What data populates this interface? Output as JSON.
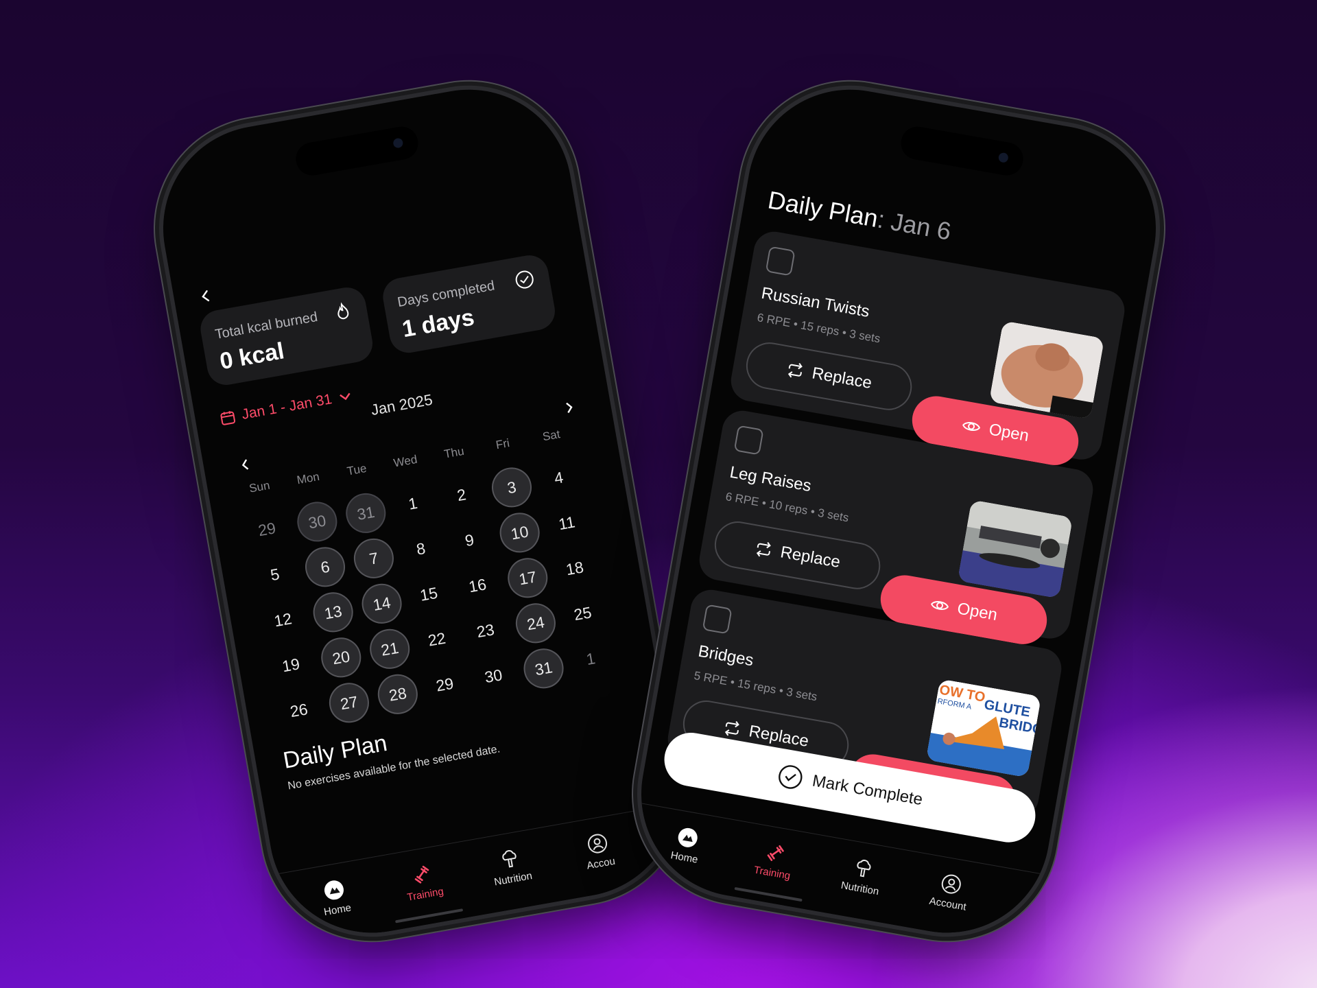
{
  "colors": {
    "accent": "#f34a62",
    "card": "#1c1c1e",
    "muted": "#8d8d92"
  },
  "calendar_screen": {
    "kcal_label": "Total kcal burned",
    "kcal_value": "0 kcal",
    "days_label": "Days completed",
    "days_value": "1 days",
    "range": "Jan 1 - Jan 31",
    "month": "Jan 2025",
    "weekdays": [
      "Sun",
      "Mon",
      "Tue",
      "Wed",
      "Thu",
      "Fri",
      "Sat"
    ],
    "weeks": [
      [
        "29",
        "30",
        "31",
        "1",
        "2",
        "3",
        "4"
      ],
      [
        "5",
        "6",
        "7",
        "8",
        "9",
        "10",
        "11"
      ],
      [
        "12",
        "13",
        "14",
        "15",
        "16",
        "17",
        "18"
      ],
      [
        "19",
        "20",
        "21",
        "22",
        "23",
        "24",
        "25"
      ],
      [
        "26",
        "27",
        "28",
        "29",
        "30",
        "31",
        "1"
      ]
    ],
    "daily_plan_title": "Daily Plan",
    "daily_plan_empty": "No exercises available for the selected date."
  },
  "plan_screen": {
    "title": "Daily Plan",
    "date": ": Jan 6",
    "exercises": [
      {
        "name": "Russian Twists",
        "meta": "6 RPE • 15 reps • 3 sets"
      },
      {
        "name": "Leg Raises",
        "meta": "6 RPE • 10 reps • 3 sets"
      },
      {
        "name": "Bridges",
        "meta": "5 RPE • 15 reps • 3 sets",
        "thumb_text_1": "OW TO",
        "thumb_text_2": "RFORM A",
        "thumb_text_3": "GLUTE",
        "thumb_text_4": "BRIDG"
      }
    ],
    "replace_label": "Replace",
    "open_label": "Open",
    "mark_complete": "Mark Complete"
  },
  "tabs": {
    "home": "Home",
    "training": "Training",
    "nutrition": "Nutrition",
    "account": "Account",
    "account_cut": "Accou"
  }
}
